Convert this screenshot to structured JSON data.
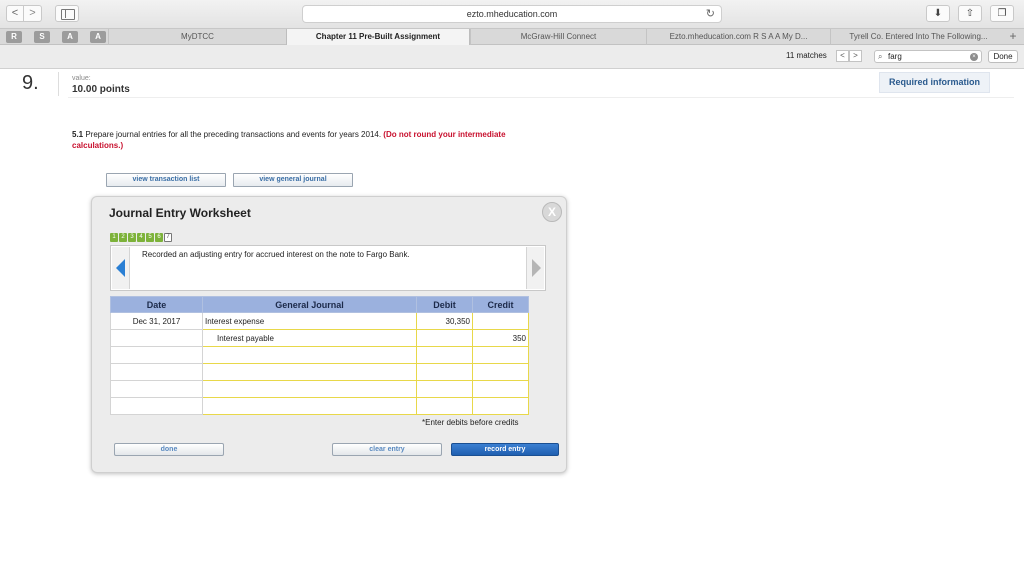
{
  "browser": {
    "url": "ezto.mheducation.com",
    "nav_back": "<",
    "nav_forward": ">",
    "bookmarks": [
      "R",
      "S",
      "A",
      "A"
    ],
    "tabs": [
      {
        "label": "MyDTCC",
        "active": false
      },
      {
        "label": "Chapter 11 Pre-Built Assignment",
        "active": true
      },
      {
        "label": "McGraw-Hill Connect",
        "active": false
      },
      {
        "label": "Ezto.mheducation.com R S A A My D...",
        "active": false
      },
      {
        "label": "Tyrell Co. Entered Into The Following...",
        "active": false
      }
    ],
    "new_tab": "+",
    "find": {
      "matches": "11 matches",
      "prev": "<",
      "next": ">",
      "query": "farg",
      "done_label": "Done"
    }
  },
  "question": {
    "number": "9.",
    "value_label": "value:",
    "points": "10.00 points",
    "required_info": "Required information",
    "instruction_prefix": "5.1",
    "instruction_text": " Prepare journal entries for all the preceding transactions and events for years 2014. ",
    "instruction_red": "(Do not round your intermediate calculations.)",
    "view_transaction_list": "view transaction list",
    "view_general_journal": "view general journal"
  },
  "worksheet": {
    "title": "Journal Entry Worksheet",
    "close": "X",
    "steps": [
      "1",
      "2",
      "3",
      "4",
      "5",
      "6",
      "7"
    ],
    "current_step": "7",
    "description": "Recorded an adjusting entry for accrued interest on the note to Fargo Bank.",
    "columns": {
      "date": "Date",
      "general_journal": "General Journal",
      "debit": "Debit",
      "credit": "Credit"
    },
    "rows": [
      {
        "date": "Dec 31, 2017",
        "account": "Interest expense",
        "debit": "30,350",
        "credit": ""
      },
      {
        "date": "",
        "account": "Interest payable",
        "debit": "",
        "credit": "350"
      },
      {
        "date": "",
        "account": "",
        "debit": "",
        "credit": ""
      },
      {
        "date": "",
        "account": "",
        "debit": "",
        "credit": ""
      },
      {
        "date": "",
        "account": "",
        "debit": "",
        "credit": ""
      },
      {
        "date": "",
        "account": "",
        "debit": "",
        "credit": ""
      }
    ],
    "note": "*Enter debits before credits",
    "done_label": "done",
    "clear_label": "clear entry",
    "record_label": "record entry"
  }
}
